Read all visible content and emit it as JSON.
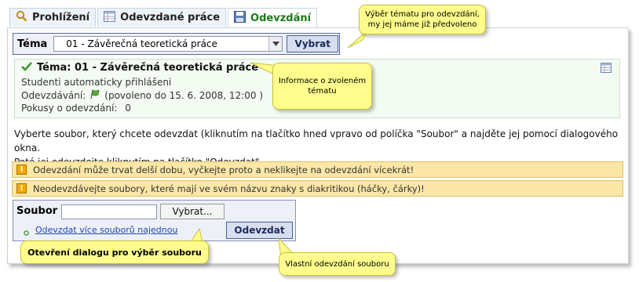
{
  "tabs": [
    {
      "label": "Prohlížení",
      "icon": "magnifier-icon"
    },
    {
      "label": "Odevzdané práce",
      "icon": "table-icon"
    },
    {
      "label": "Odevzdání",
      "icon": "floppy-disk-icon",
      "active": true
    }
  ],
  "topic_select": {
    "label": "Téma",
    "selected": "01 - Závěrečná teoretická práce",
    "button": "Vybrat"
  },
  "topic_info": {
    "title": "Téma: 01 - Závěrečná teoretická práce",
    "line1": "Studenti automaticky přihlášeni",
    "submission_label": "Odevzdávání:",
    "submission_value": "(povoleno do 15. 6. 2008, 12:00 )",
    "attempts_label": "Pokusy o odevzdání:",
    "attempts_value": "0"
  },
  "description": {
    "line1": "Vyberte soubor, který chcete odevzdat (kliknutím na tlačítko hned vpravo od políčka \"Soubor\" a najděte jej pomocí dialogového okna.",
    "line2": "Poté jej odevzdejte kliknutím na tlačítko \"Odevzdat\"."
  },
  "warnings": [
    "Odevzdání může trvat delší dobu, vyčkejte proto a neklikejte na odevzdání vícekrát!",
    "Neodevzdávejte soubory, které mají ve svém názvu znaky s diakritikou (háčky, čárky)!"
  ],
  "upload": {
    "file_label": "Soubor",
    "file_value": "",
    "browse_button": "Vybrat...",
    "multi_link": "Odevzdat více souborů najednou",
    "submit_button": "Odevzdat"
  },
  "callouts": {
    "topic": "Výběr tématu pro odevzdání, my jej máme již předvoleno",
    "info": "Informace o zvoleném tématu",
    "dialog": "Otevření dialogu pro výběr souboru",
    "submit": "Vlastní odevzdání souboru"
  },
  "colors": {
    "active_tab_text": "#1a7a1a",
    "callout_bg": "#fdfc8c",
    "warning_bg": "#fbe7a6",
    "link": "#1f46a8",
    "button_border": "#4c5f94"
  }
}
